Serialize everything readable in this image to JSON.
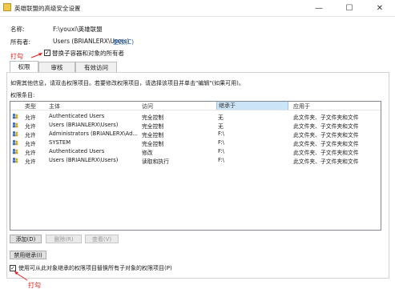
{
  "window": {
    "title": "英雄联盟的高级安全设置",
    "controls": {
      "minimize": "—",
      "maximize": "☐",
      "close": "✕"
    }
  },
  "name_label": "名称:",
  "name_value": "F:\\youxi\\英雄联盟",
  "owner_label": "所有者:",
  "owner_value": "Users (BRIANLERX\\Users)",
  "owner_change_link": "更改(C)",
  "replace_owner_checkbox": {
    "label": "替换子容器和对象的所有者",
    "checked": true
  },
  "annotation_top": "打勾",
  "annotation_bottom": "打勾",
  "tabs": [
    {
      "label": "权限",
      "active": true
    },
    {
      "label": "审核",
      "active": false
    },
    {
      "label": "有效访问",
      "active": false
    }
  ],
  "info_text": "如需其他信息，请双击权限项目。若要修改权限项目，请选择该项目并单击\"编辑\"(如果可用)。",
  "permission_entries_label": "权限条目:",
  "columns": {
    "type": "类型",
    "principal": "主体",
    "access": "访问",
    "inherited_from": "继承于",
    "applies_to": "应用于"
  },
  "rows": [
    {
      "type": "允许",
      "principal": "Authenticated Users",
      "access": "完全控制",
      "inherited_from": "无",
      "applies_to": "此文件夹、子文件夹和文件"
    },
    {
      "type": "允许",
      "principal": "Users (BRIANLERX\\Users)",
      "access": "完全控制",
      "inherited_from": "无",
      "applies_to": "此文件夹、子文件夹和文件"
    },
    {
      "type": "允许",
      "principal": "Administrators (BRIANLERX\\Ad...",
      "access": "完全控制",
      "inherited_from": "F:\\",
      "applies_to": "此文件夹、子文件夹和文件"
    },
    {
      "type": "允许",
      "principal": "SYSTEM",
      "access": "完全控制",
      "inherited_from": "F:\\",
      "applies_to": "此文件夹、子文件夹和文件"
    },
    {
      "type": "允许",
      "principal": "Authenticated Users",
      "access": "修改",
      "inherited_from": "F:\\",
      "applies_to": "此文件夹、子文件夹和文件"
    },
    {
      "type": "允许",
      "principal": "Users (BRIANLERX\\Users)",
      "access": "读取和执行",
      "inherited_from": "F:\\",
      "applies_to": "此文件夹、子文件夹和文件"
    }
  ],
  "buttons": {
    "add": "添加(D)",
    "remove": "删除(R)",
    "view": "查看(V)",
    "disable_inheritance": "禁用继承(I)"
  },
  "replace_child_checkbox": {
    "label": "使用可从此对象继承的权限项目替换所有子对象的权限项目(P)",
    "checked": true
  },
  "colors": {
    "annotation": "#e02020",
    "link": "#1a5fb4",
    "header_selected": "#cce4f7"
  }
}
